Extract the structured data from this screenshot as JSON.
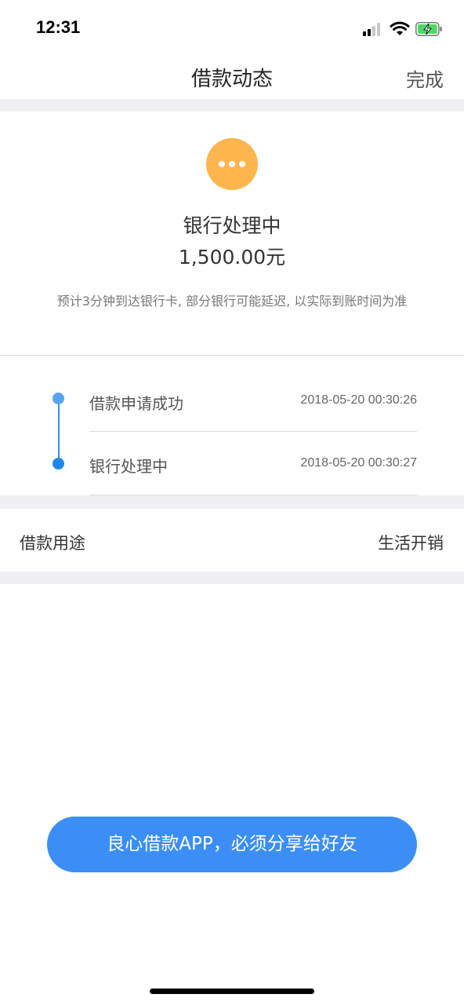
{
  "status_bar": {
    "time": "12:31",
    "icons": [
      "cellular-signal-icon",
      "wifi-icon",
      "battery-charging-icon"
    ]
  },
  "nav": {
    "title": "借款动态",
    "done_label": "完成"
  },
  "status": {
    "icon": "more-dots-icon",
    "icon_color": "#ffb54d",
    "title": "银行处理中",
    "amount": "1,500.00元",
    "description": "预计3分钟到达银行卡, 部分银行可能延迟, 以实际到账时间为准"
  },
  "timeline": [
    {
      "label": "借款申请成功",
      "time": "2018-05-20 00:30:26"
    },
    {
      "label": "银行处理中",
      "time": "2018-05-20 00:30:27"
    }
  ],
  "purpose": {
    "label": "借款用途",
    "value": "生活开销"
  },
  "share_button": {
    "label": "良心借款APP，必须分享给好友",
    "color": "#3b8ef6"
  },
  "colors": {
    "accent_blue": "#3a8ff0",
    "pending_orange": "#ffb54d",
    "background_gray": "#efeff4"
  }
}
